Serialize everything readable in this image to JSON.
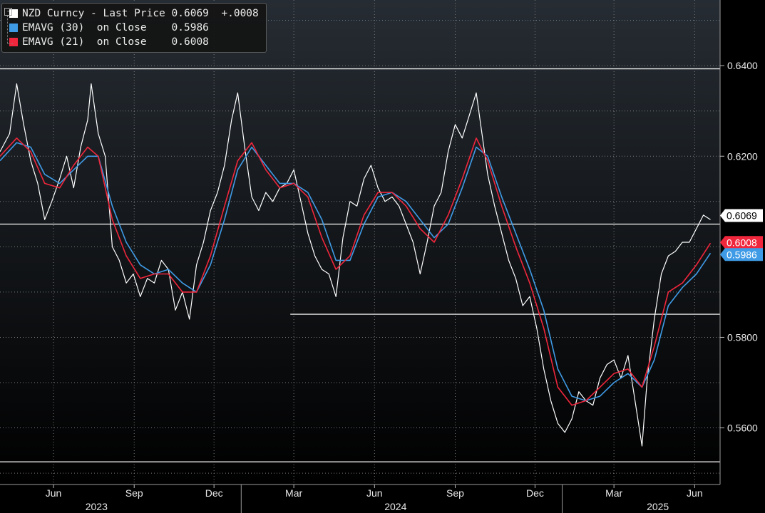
{
  "legend": {
    "series0": {
      "label": "NZD Curncy - Last Price",
      "value": "0.6069",
      "change": "+.0008",
      "color": "#ffffff"
    },
    "series1": {
      "label": "EMAVG (30)  on Close",
      "value": "0.5986",
      "color": "#3f9be6"
    },
    "series2": {
      "label": "EMAVG (21)  on Close",
      "value": "0.6008",
      "color": "#f0263c"
    }
  },
  "colors": {
    "background_top": "#262c33",
    "background_bottom": "#000000",
    "price": "#ffffff",
    "ema30": "#3f9be6",
    "ema21": "#f0263c",
    "grid": "#8a8a8a"
  },
  "chart_data": {
    "type": "line",
    "title": "",
    "xlabel": "",
    "ylabel": "",
    "ylim": [
      0.5475,
      0.6545
    ],
    "grid": "dotted",
    "y_ticks": [
      "0.5600",
      "0.5800",
      "0.6200",
      "0.6400"
    ],
    "x_ticks": [
      "Jun",
      "Sep",
      "Dec",
      "Mar",
      "Jun",
      "Sep",
      "Dec",
      "Mar",
      "Jun"
    ],
    "year_labels": [
      "2023",
      "2024",
      "2025"
    ],
    "price_labels": [
      {
        "text": "0.6069",
        "value": 0.6069,
        "series": "NZD Curncy - Last Price"
      },
      {
        "text": "0.6008",
        "value": 0.6008,
        "series": "EMAVG (21) on Close"
      },
      {
        "text": "0.5986",
        "value": 0.5986,
        "series": "EMAVG (30) on Close"
      }
    ],
    "hlines": [
      {
        "value": 0.6393,
        "from": "2023-04-01",
        "to": "2025-06-30"
      },
      {
        "value": 0.605,
        "from": "2023-04-01",
        "to": "2025-06-30"
      },
      {
        "value": 0.5851,
        "from": "2024-02-26",
        "to": "2025-06-30"
      },
      {
        "value": 0.5525,
        "from": "2023-04-01",
        "to": "2025-06-30"
      }
    ],
    "x_range": [
      "2023-04-01",
      "2025-06-30"
    ],
    "series": [
      {
        "name": "NZD Curncy - Last Price",
        "x": [
          "2023-04-01",
          "2023-04-12",
          "2023-04-20",
          "2023-04-28",
          "2023-05-06",
          "2023-05-14",
          "2023-05-22",
          "2023-05-30",
          "2023-06-08",
          "2023-06-16",
          "2023-06-24",
          "2023-07-02",
          "2023-07-10",
          "2023-07-14",
          "2023-07-22",
          "2023-07-30",
          "2023-08-07",
          "2023-08-15",
          "2023-08-23",
          "2023-08-31",
          "2023-09-08",
          "2023-09-16",
          "2023-09-24",
          "2023-10-02",
          "2023-10-10",
          "2023-10-18",
          "2023-10-26",
          "2023-11-03",
          "2023-11-11",
          "2023-11-19",
          "2023-11-27",
          "2023-12-05",
          "2023-12-13",
          "2023-12-21",
          "2023-12-28",
          "2024-01-05",
          "2024-01-13",
          "2024-01-21",
          "2024-01-29",
          "2024-02-06",
          "2024-02-14",
          "2024-02-22",
          "2024-03-01",
          "2024-03-09",
          "2024-03-17",
          "2024-03-25",
          "2024-04-02",
          "2024-04-10",
          "2024-04-18",
          "2024-04-26",
          "2024-05-04",
          "2024-05-12",
          "2024-05-20",
          "2024-05-28",
          "2024-06-05",
          "2024-06-13",
          "2024-06-21",
          "2024-06-29",
          "2024-07-07",
          "2024-07-15",
          "2024-07-23",
          "2024-07-31",
          "2024-08-08",
          "2024-08-16",
          "2024-08-24",
          "2024-09-01",
          "2024-09-09",
          "2024-09-17",
          "2024-09-25",
          "2024-09-30",
          "2024-10-08",
          "2024-10-16",
          "2024-10-24",
          "2024-11-01",
          "2024-11-09",
          "2024-11-17",
          "2024-11-25",
          "2024-12-03",
          "2024-12-11",
          "2024-12-19",
          "2024-12-27",
          "2025-01-04",
          "2025-01-12",
          "2025-01-20",
          "2025-01-28",
          "2025-02-05",
          "2025-02-13",
          "2025-02-21",
          "2025-03-01",
          "2025-03-09",
          "2025-03-17",
          "2025-03-25",
          "2025-04-02",
          "2025-04-08",
          "2025-04-16",
          "2025-04-24",
          "2025-05-02",
          "2025-05-10",
          "2025-05-18",
          "2025-05-26",
          "2025-06-03",
          "2025-06-11",
          "2025-06-19"
        ],
        "values": [
          0.621,
          0.625,
          0.636,
          0.627,
          0.619,
          0.614,
          0.606,
          0.61,
          0.615,
          0.62,
          0.613,
          0.622,
          0.628,
          0.636,
          0.625,
          0.62,
          0.6,
          0.597,
          0.592,
          0.594,
          0.589,
          0.593,
          0.592,
          0.597,
          0.595,
          0.586,
          0.59,
          0.584,
          0.596,
          0.601,
          0.608,
          0.612,
          0.618,
          0.628,
          0.634,
          0.622,
          0.611,
          0.608,
          0.612,
          0.61,
          0.613,
          0.614,
          0.617,
          0.61,
          0.603,
          0.598,
          0.595,
          0.594,
          0.589,
          0.602,
          0.61,
          0.609,
          0.615,
          0.618,
          0.613,
          0.61,
          0.611,
          0.609,
          0.605,
          0.601,
          0.594,
          0.601,
          0.609,
          0.612,
          0.621,
          0.627,
          0.624,
          0.629,
          0.634,
          0.627,
          0.616,
          0.609,
          0.603,
          0.597,
          0.593,
          0.587,
          0.589,
          0.582,
          0.573,
          0.566,
          0.561,
          0.559,
          0.562,
          0.568,
          0.566,
          0.565,
          0.571,
          0.574,
          0.575,
          0.571,
          0.576,
          0.566,
          0.556,
          0.571,
          0.584,
          0.594,
          0.598,
          0.599,
          0.601,
          0.601,
          0.604,
          0.607,
          0.606
        ]
      },
      {
        "name": "EMAVG (30) on Close",
        "x": [
          "2023-04-01",
          "2023-04-20",
          "2023-05-06",
          "2023-05-22",
          "2023-06-08",
          "2023-06-24",
          "2023-07-10",
          "2023-07-22",
          "2023-08-07",
          "2023-08-23",
          "2023-09-08",
          "2023-09-24",
          "2023-10-10",
          "2023-10-26",
          "2023-11-11",
          "2023-11-27",
          "2023-12-13",
          "2023-12-28",
          "2024-01-13",
          "2024-01-29",
          "2024-02-14",
          "2024-03-01",
          "2024-03-17",
          "2024-04-02",
          "2024-04-18",
          "2024-05-04",
          "2024-05-20",
          "2024-06-05",
          "2024-06-21",
          "2024-07-07",
          "2024-07-23",
          "2024-08-08",
          "2024-08-24",
          "2024-09-09",
          "2024-09-25",
          "2024-10-08",
          "2024-10-24",
          "2024-11-09",
          "2024-11-25",
          "2024-12-11",
          "2024-12-27",
          "2025-01-12",
          "2025-01-28",
          "2025-02-13",
          "2025-03-01",
          "2025-03-17",
          "2025-04-02",
          "2025-04-16",
          "2025-05-02",
          "2025-05-18",
          "2025-06-03",
          "2025-06-19"
        ],
        "values": [
          0.619,
          0.623,
          0.622,
          0.616,
          0.614,
          0.617,
          0.62,
          0.62,
          0.609,
          0.601,
          0.596,
          0.594,
          0.595,
          0.592,
          0.59,
          0.596,
          0.606,
          0.617,
          0.622,
          0.618,
          0.614,
          0.614,
          0.612,
          0.606,
          0.597,
          0.597,
          0.605,
          0.611,
          0.612,
          0.61,
          0.606,
          0.602,
          0.605,
          0.613,
          0.622,
          0.62,
          0.611,
          0.603,
          0.595,
          0.586,
          0.573,
          0.567,
          0.566,
          0.567,
          0.57,
          0.572,
          0.569,
          0.575,
          0.587,
          0.591,
          0.594,
          0.5986
        ]
      },
      {
        "name": "EMAVG (21) on Close",
        "x": [
          "2023-04-01",
          "2023-04-20",
          "2023-05-06",
          "2023-05-22",
          "2023-06-08",
          "2023-06-24",
          "2023-07-10",
          "2023-07-22",
          "2023-08-07",
          "2023-08-23",
          "2023-09-08",
          "2023-09-24",
          "2023-10-10",
          "2023-10-26",
          "2023-11-11",
          "2023-11-27",
          "2023-12-13",
          "2023-12-28",
          "2024-01-13",
          "2024-01-29",
          "2024-02-14",
          "2024-03-01",
          "2024-03-17",
          "2024-04-02",
          "2024-04-18",
          "2024-05-04",
          "2024-05-20",
          "2024-06-05",
          "2024-06-21",
          "2024-07-07",
          "2024-07-23",
          "2024-08-08",
          "2024-08-24",
          "2024-09-09",
          "2024-09-25",
          "2024-10-08",
          "2024-10-24",
          "2024-11-09",
          "2024-11-25",
          "2024-12-11",
          "2024-12-27",
          "2025-01-12",
          "2025-01-28",
          "2025-02-13",
          "2025-03-01",
          "2025-03-17",
          "2025-04-02",
          "2025-04-16",
          "2025-05-02",
          "2025-05-18",
          "2025-06-03",
          "2025-06-19"
        ],
        "values": [
          0.62,
          0.624,
          0.621,
          0.614,
          0.613,
          0.618,
          0.622,
          0.62,
          0.606,
          0.598,
          0.593,
          0.594,
          0.594,
          0.59,
          0.59,
          0.598,
          0.609,
          0.619,
          0.623,
          0.617,
          0.613,
          0.614,
          0.611,
          0.602,
          0.595,
          0.598,
          0.607,
          0.612,
          0.612,
          0.609,
          0.604,
          0.601,
          0.607,
          0.615,
          0.624,
          0.619,
          0.609,
          0.6,
          0.592,
          0.582,
          0.569,
          0.565,
          0.566,
          0.569,
          0.572,
          0.573,
          0.569,
          0.578,
          0.59,
          0.592,
          0.596,
          0.6008
        ]
      }
    ]
  }
}
